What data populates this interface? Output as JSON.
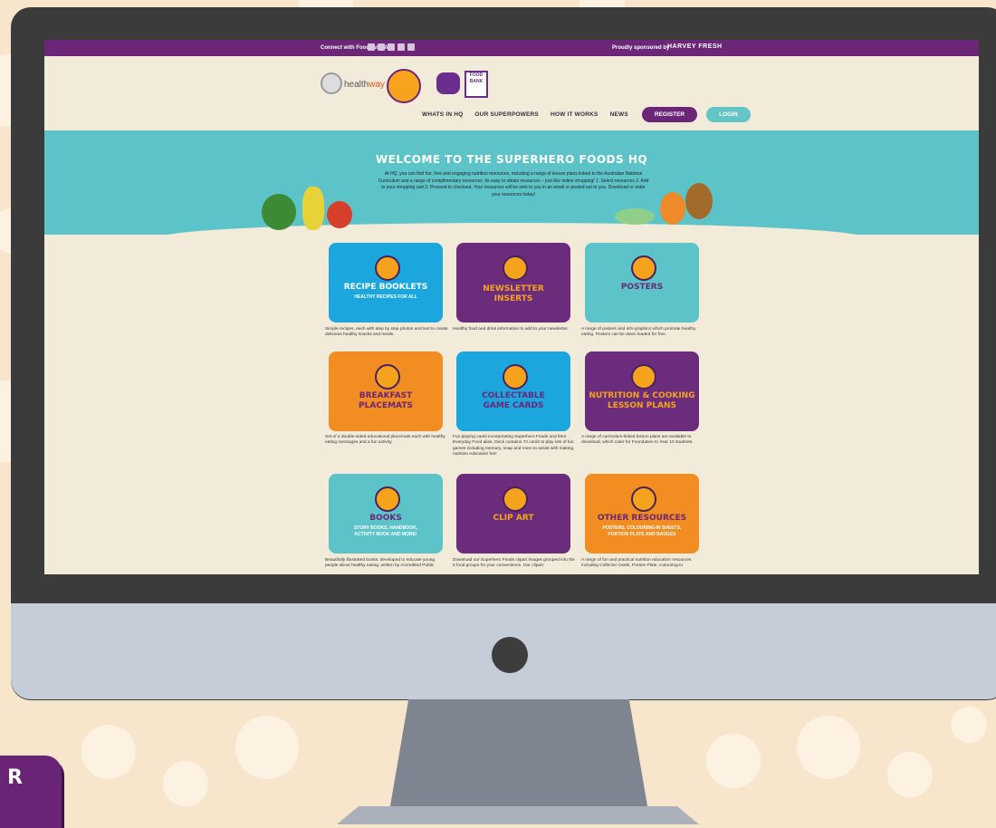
{
  "colors": {
    "purple": "#6b2677",
    "teal": "#5cc4c9",
    "blue": "#1aa8dc",
    "orange": "#f28d22",
    "cream": "#f2ebda",
    "yellow_text": "#f5a31c"
  },
  "topbar": {
    "connect_label": "Connect with Foodbank WA",
    "sponsor_label": "Proudly sponsored by",
    "sponsor_logo_text": "HARVEY FRESH"
  },
  "logos": {
    "healthway": {
      "prefix": "health",
      "suffix": "way"
    },
    "foodbank": "FOOD BANK"
  },
  "nav": {
    "items": [
      "WHATS IN HQ",
      "OUR SUPERPOWERS",
      "HOW IT WORKS",
      "NEWS"
    ],
    "register": "REGISTER",
    "login": "LOGIN"
  },
  "hero": {
    "title": "WELCOME TO THE SUPERHERO FOODS HQ",
    "text": "At HQ, you can find fun, free and engaging nutrition resources, including a range of lesson plans linked to the Australian National Curriculum and a range of complimentary resources. Its easy to obtain resources – just like online shopping! 1. Select resources 2. Add to your shopping cart 3. Proceed to checkout. Your resources will be sent to you in an email or posted out to you. Download or order your resources today!"
  },
  "cards": [
    {
      "title": "RECIPE BOOKLETS",
      "subtitle": "HEALTHY RECIPES FOR ALL",
      "desc": "Simple recipes, each with step by step photos and text to create delicious healthy snacks and meals."
    },
    {
      "title": "NEWSLETTER INSERTS",
      "subtitle": "",
      "desc": "Healthy food and drink information to add to your newsletter."
    },
    {
      "title": "POSTERS",
      "subtitle": "",
      "desc": "A range of posters and info-graphics which promote healthy eating. Posters can be down loaded for free."
    },
    {
      "title": "BREAKFAST PLACEMATS",
      "subtitle": "",
      "desc": "Set of 4 double-sided educational placemats each with healthy eating messages and a fun activity."
    },
    {
      "title": "COLLECTABLE GAME CARDS",
      "subtitle": "",
      "desc": "Fun playing cards incorporating Superhero Foods and their Everyday Food alias. Deck contains 74 cards to play lots of fun games including memory, snap and more to assist with making nutrition education fun!"
    },
    {
      "title": "NUTRITION & COOKING LESSON PLANS",
      "subtitle": "",
      "desc": "A range of curriculum-linked lesson plans are available to download, which cater for Foundation to Year 10 students."
    },
    {
      "title": "BOOKS",
      "subtitle": "STORY BOOKS, HANDBOOK, ACTIVITY BOOK AND MORE!",
      "desc": "Beautifully illustrated books, developed to educate young people about healthy eating, written by Accredited Public"
    },
    {
      "title": "CLIP ART",
      "subtitle": "",
      "desc": "Download our Superhero Foods clipart images grouped into the 5 food groups for your convenience. Our clipart"
    },
    {
      "title": "OTHER RESOURCES",
      "subtitle": "POSTERS, COLOURING-IN SHEETS, PORTION PLATE AND BADGES",
      "desc": "A range of fun and practical nutrition education resources including Collector Cards, Portion Plate, Colouring-in"
    }
  ],
  "badge": "R"
}
